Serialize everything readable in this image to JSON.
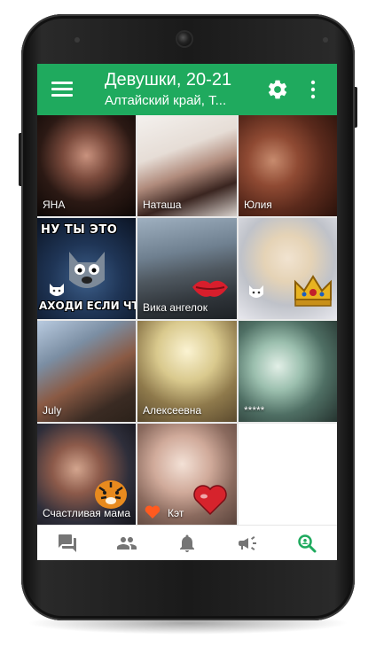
{
  "colors": {
    "accent": "#1faa5e",
    "nav_inactive": "#757575",
    "nav_active": "#1faa5e"
  },
  "appbar": {
    "title": "Девушки, 20-21",
    "subtitle": "Алтайский край, Т...",
    "menu_icon": "hamburger-menu-icon",
    "settings_icon": "gear-icon",
    "more_icon": "more-vert-icon"
  },
  "profiles": [
    {
      "name": "ЯНА"
    },
    {
      "name": "Наташа"
    },
    {
      "name": "Юлия"
    },
    {
      "name": "",
      "meme_top": "НУ ТЫ ЭТО",
      "meme_bottom": "АХОДИ ЕСЛИ ЧТ"
    },
    {
      "name": "Вика ангелок"
    },
    {
      "name": ""
    },
    {
      "name": "July"
    },
    {
      "name": "Алексеевна"
    },
    {
      "name": "*****"
    },
    {
      "name": "Счастливая мама"
    },
    {
      "name": "Кэт"
    }
  ],
  "bottom_nav": [
    {
      "icon": "chat-icon",
      "active": false
    },
    {
      "icon": "people-icon",
      "active": false
    },
    {
      "icon": "notifications-bell-icon",
      "active": false
    },
    {
      "icon": "megaphone-icon",
      "active": false
    },
    {
      "icon": "search-people-icon",
      "active": true
    }
  ]
}
